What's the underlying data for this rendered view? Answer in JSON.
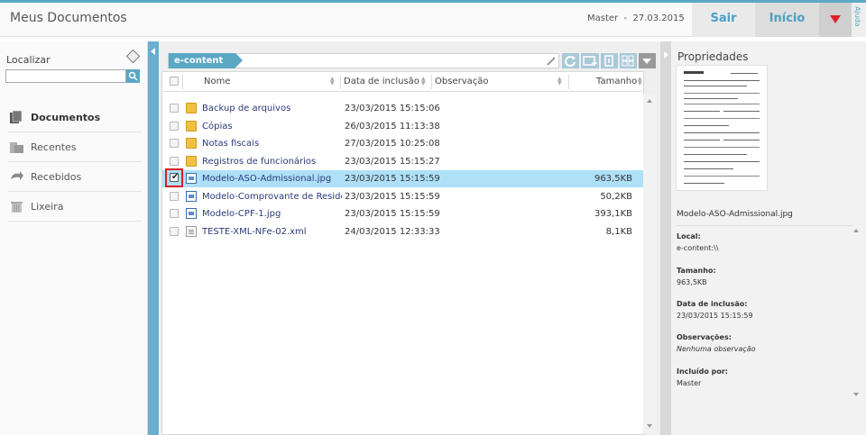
{
  "app": {
    "title": "Meus Documentos"
  },
  "header": {
    "user": "Master",
    "separator": "-",
    "date": "27.03.2015",
    "sair_label": "Sair",
    "inicio_label": "Início",
    "ajuda_label": "Ajuda"
  },
  "sidebar": {
    "search_label": "Localizar",
    "search_value": "",
    "items": [
      {
        "label": "Documentos",
        "icon": "documents-icon",
        "active": true
      },
      {
        "label": "Recentes",
        "icon": "recent-icon",
        "active": false
      },
      {
        "label": "Recebidos",
        "icon": "received-icon",
        "active": false
      },
      {
        "label": "Lixeira",
        "icon": "trash-icon",
        "active": false
      }
    ]
  },
  "path": {
    "crumb": "e-content"
  },
  "columns": {
    "name": "Nome",
    "date": "Data de inclusão",
    "note": "Observação",
    "size": "Tamanho"
  },
  "files": [
    {
      "name": "Backup de arquivos",
      "date": "23/03/2015 15:15:06",
      "size": "",
      "type": "folder",
      "selected": false
    },
    {
      "name": "Cópias",
      "date": "26/03/2015 11:13:38",
      "size": "",
      "type": "folder",
      "selected": false
    },
    {
      "name": "Notas fiscais",
      "date": "27/03/2015 10:25:08",
      "size": "",
      "type": "folder",
      "selected": false
    },
    {
      "name": "Registros de funcionários",
      "date": "23/03/2015 15:15:27",
      "size": "",
      "type": "folder",
      "selected": false
    },
    {
      "name": "Modelo-ASO-Admissional.jpg",
      "date": "23/03/2015 15:15:59",
      "size": "963,5KB",
      "type": "image",
      "selected": true
    },
    {
      "name": "Modelo-Comprovante de Residência",
      "date": "23/03/2015 15:15:59",
      "size": "50,2KB",
      "type": "image",
      "selected": false
    },
    {
      "name": "Modelo-CPF-1.jpg",
      "date": "23/03/2015 15:15:59",
      "size": "393,1KB",
      "type": "image",
      "selected": false
    },
    {
      "name": "TESTE-XML-NFe-02.xml",
      "date": "24/03/2015 12:33:33",
      "size": "8,1KB",
      "type": "xml",
      "selected": false
    }
  ],
  "properties": {
    "title": "Propriedades",
    "filename": "Modelo-ASO-Admissional.jpg",
    "local_label": "Local:",
    "local_value": "e-content:\\\\",
    "size_label": "Tamanho:",
    "size_value": "963,5KB",
    "date_label": "Data de inclusão:",
    "date_value": "23/03/2015 15:15:59",
    "notes_label": "Observações:",
    "notes_value": "Nenhuma observação",
    "by_label": "Incluído por:",
    "by_value": "Master"
  },
  "colors": {
    "accent": "#5aa8c4",
    "selected_row": "#aee0f8",
    "menu_triangle": "#e0202a",
    "selection_highlight": "#d8202a"
  }
}
